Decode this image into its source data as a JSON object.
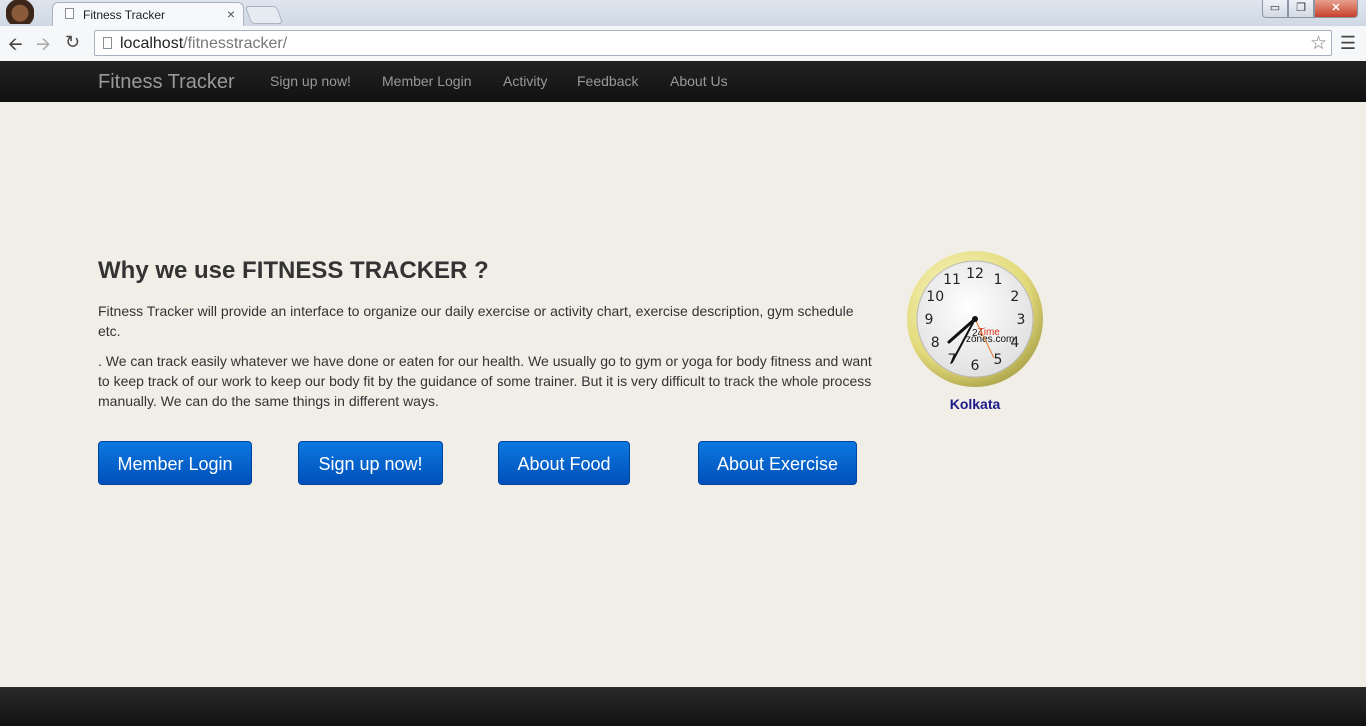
{
  "browser": {
    "tab_title": "Fitness Tracker",
    "tab_close": "×",
    "url_host": "localhost",
    "url_path": "/fitnesstracker/",
    "window_minimize": "▭",
    "window_restore": "❐",
    "window_close": "✕"
  },
  "navbar": {
    "brand": "Fitness Tracker",
    "links": [
      "Sign up now!",
      "Member Login",
      "Activity",
      "Feedback",
      "About Us"
    ]
  },
  "hero": {
    "heading": "Why we use FITNESS TRACKER ?",
    "paragraph1": "Fitness Tracker will provide an interface to organize our daily exercise or activity chart, exercise description, gym schedule etc.",
    "paragraph2": ". We can track easily whatever we have done or eaten for our health. We usually go to gym or yoga for body fitness and want to keep track of our work to keep our body fit by the guidance of some trainer. But it is very difficult to track the whole process manually. We can do the same things in different ways.",
    "buttons": [
      "Member Login",
      "Sign up now!",
      "About Food",
      "About Exercise"
    ]
  },
  "clock": {
    "numbers": [
      "12",
      "1",
      "2",
      "3",
      "4",
      "5",
      "6",
      "7",
      "8",
      "9",
      "10",
      "11"
    ],
    "brand_24": "24",
    "brand_time": "Time",
    "brand_zones": "zones.com",
    "city": "Kolkata",
    "time_shown": "7:40"
  },
  "colors": {
    "page_bg": "#f1eee8",
    "navbar_bg": "#1b1b1b",
    "button_blue": "#0a63c9",
    "city_label": "#1a1a8a"
  }
}
